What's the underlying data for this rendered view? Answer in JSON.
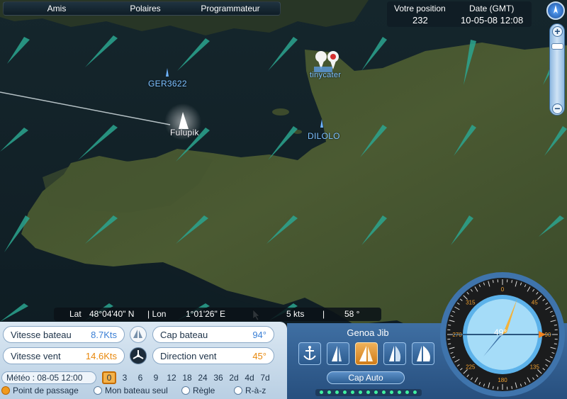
{
  "topnav": {
    "items": [
      "Amis",
      "Polaires",
      "Programmateur"
    ]
  },
  "position": {
    "rank_label": "Votre position",
    "rank_value": "232",
    "date_label": "Date (GMT)",
    "date_value": "10-05-08 12:08"
  },
  "map": {
    "boats": [
      {
        "name": "GER3622"
      },
      {
        "name": "Fulupik"
      },
      {
        "name": "DILOLO"
      },
      {
        "name": "tinycater"
      }
    ]
  },
  "coords": {
    "lat_label": "Lat",
    "lat_value": "48°04'40\" N",
    "lon_label": "| Lon",
    "lon_value": "1°01'26\" E",
    "speed": "5 kts",
    "separator": "|",
    "heading": "58 °"
  },
  "stats": {
    "boat_speed_label": "Vitesse bateau",
    "boat_speed_value": "8.7Kts",
    "wind_speed_label": "Vitesse vent",
    "wind_speed_value": "14.6Kts",
    "heading_label": "Cap bateau",
    "heading_value": "94°",
    "wind_dir_label": "Direction vent",
    "wind_dir_value": "45°"
  },
  "meteo": {
    "label": "Météo  : 08-05 12:00",
    "steps": [
      "0",
      "3",
      "6",
      "9",
      "12",
      "18",
      "24",
      "36",
      "2d",
      "4d",
      "7d"
    ],
    "active_step": "0"
  },
  "filters": [
    {
      "label": "Point de passage",
      "on": true
    },
    {
      "label": "Mon bateau seul",
      "on": false
    },
    {
      "label": "Règle",
      "on": false
    },
    {
      "label": "R-à-z",
      "on": false
    }
  ],
  "sails": {
    "title": "Genoa Jib",
    "buttons": [
      "anchor-icon",
      "jib-sail-icon",
      "genoa-sail-icon",
      "spinnaker-icon",
      "gennaker-icon"
    ],
    "active_index": 2,
    "cap_auto_label": "Cap Auto"
  },
  "compass": {
    "center_value": "49°",
    "ticks": [
      "0",
      "45",
      "90",
      "135",
      "180",
      "225",
      "270",
      "315"
    ]
  },
  "colors": {
    "accent_orange": "#f09a1e",
    "speed_blue": "#3a7fd5",
    "wind_orange": "#e8880c",
    "panel_blue": "#2f5f94"
  }
}
